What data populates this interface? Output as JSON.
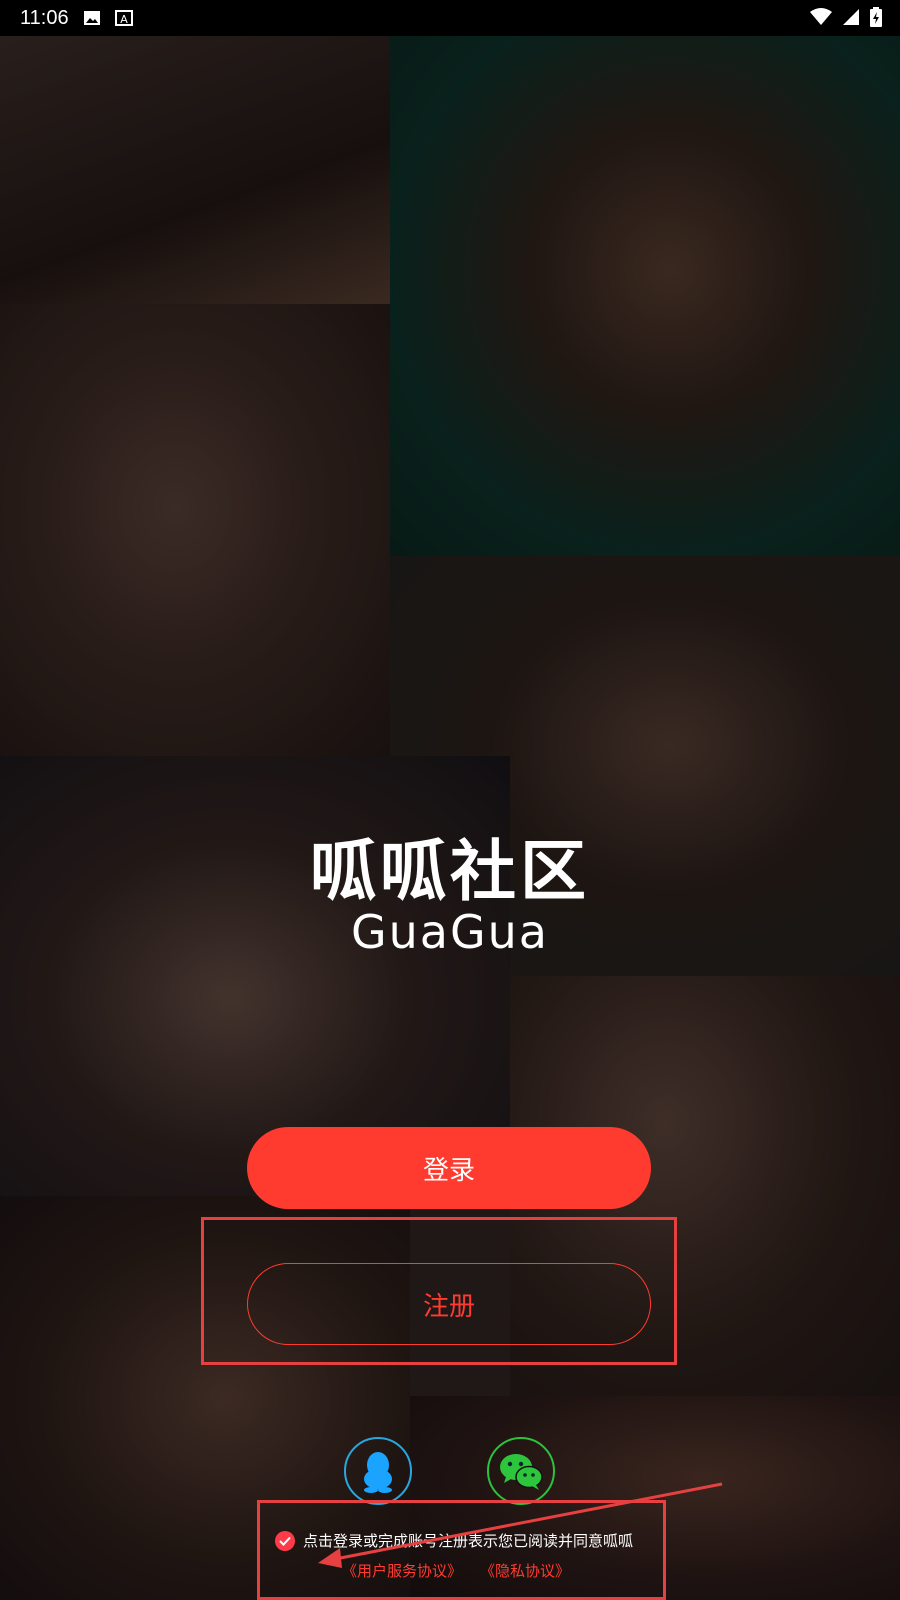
{
  "status_bar": {
    "time": "11:06",
    "icons": [
      "image-icon",
      "font-icon",
      "wifi-icon",
      "signal-icon",
      "battery-charging-icon"
    ]
  },
  "logo": {
    "cn": "呱呱社区",
    "en": "GuaGua"
  },
  "buttons": {
    "login": "登录",
    "register": "注册"
  },
  "social": {
    "qq": "qq-icon",
    "wechat": "wechat-icon"
  },
  "agreement": {
    "text": "点击登录或完成账号注册表示您已阅读并同意呱呱",
    "user_agreement": "《用户服务协议》",
    "privacy": "《隐私协议》"
  },
  "colors": {
    "accent": "#ff3b30",
    "qq_blue": "#29a8e0",
    "wechat_green": "#2cc23a",
    "annotation_red": "#e64040"
  }
}
